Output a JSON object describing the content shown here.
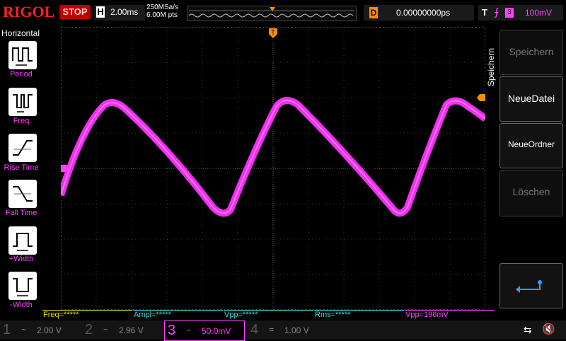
{
  "brand": "RIGOL",
  "run_state": "STOP",
  "horizontal": {
    "label": "H",
    "timebase": "2.00ms",
    "sample_rate": "250MSa/s",
    "memory_depth": "6.00M pts"
  },
  "delay": {
    "label": "D",
    "value": "0.00000000ps"
  },
  "trigger": {
    "label": "T",
    "source": "3",
    "level": "100mV"
  },
  "left_menu": {
    "title": "Horizontal",
    "items": [
      {
        "label": "Period"
      },
      {
        "label": "Freq"
      },
      {
        "label": "Rise Time"
      },
      {
        "label": "Fall Time"
      },
      {
        "label": "+Width"
      },
      {
        "label": "-Width"
      }
    ]
  },
  "right_menu": {
    "title": "Speichern",
    "items": [
      {
        "label": "Speichern",
        "enabled": false
      },
      {
        "label": "NeueDatei",
        "enabled": true
      },
      {
        "label": "NeueOrdner",
        "enabled": true
      },
      {
        "label": "Löschen",
        "enabled": false
      },
      {
        "label": "",
        "enabled": true
      }
    ]
  },
  "measurements": [
    "Freq=*****",
    "Ampl=*****",
    "Vpp=*****",
    "Rms=*****",
    "Vpp=198mV"
  ],
  "channels": [
    {
      "num": "1",
      "coupling": "~",
      "scale": "2.00 V",
      "active": false
    },
    {
      "num": "2",
      "coupling": "~",
      "scale": "2.96 V",
      "active": false
    },
    {
      "num": "3",
      "coupling": "~",
      "scale": "50.0mV",
      "active": true
    },
    {
      "num": "4",
      "coupling": "=",
      "scale": "1.00 V",
      "active": false
    }
  ],
  "colors": {
    "ch3": "#ff40ff",
    "trigger": "#ff8c00",
    "grid": "#4a4a4a",
    "brand": "#ff2020",
    "measure_yellow": "#e8e000",
    "measure_cyan": "#40e0e0"
  },
  "icons": {
    "usb": "usb-icon",
    "speaker": "speaker-muted-icon",
    "return": "return-arrow-icon"
  }
}
